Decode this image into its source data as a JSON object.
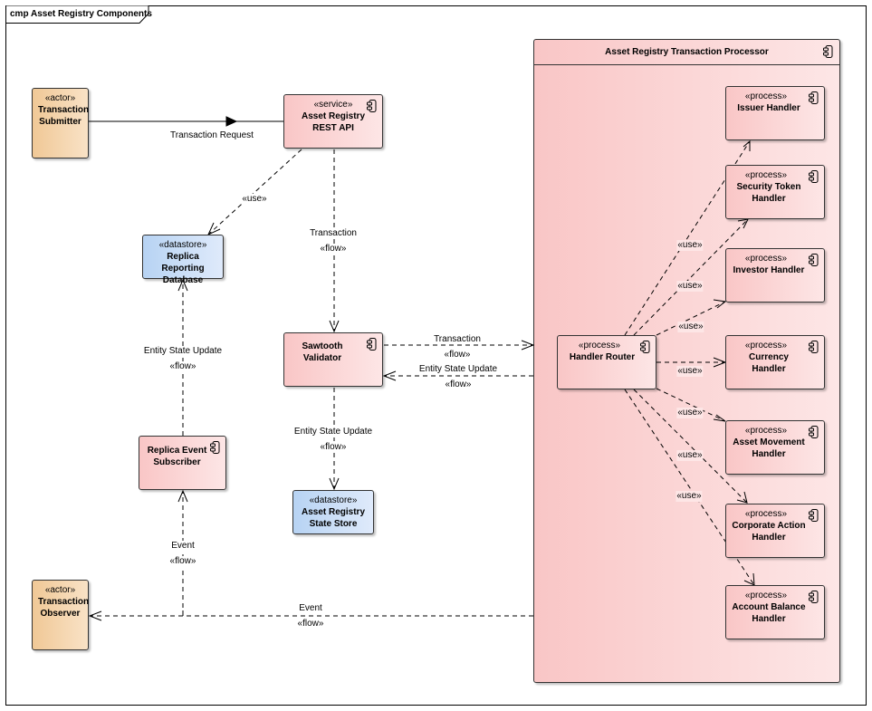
{
  "frame": {
    "title": "cmp Asset Registry Components"
  },
  "nodes": {
    "transaction_submitter": {
      "stereotype": "«actor»",
      "name_lines": [
        "Transaction",
        "Submitter"
      ]
    },
    "rest_api": {
      "stereotype": "«service»",
      "name_lines": [
        "Asset Registry",
        "REST API"
      ],
      "icon": "component-icon"
    },
    "replica_db": {
      "stereotype": "«datastore»",
      "name_lines": [
        "Replica Reporting",
        "Database"
      ]
    },
    "sawtooth_validator": {
      "name_lines": [
        "Sawtooth",
        "Validator"
      ],
      "icon": "component-icon"
    },
    "replica_subscriber": {
      "name_lines": [
        "Replica Event",
        "Subscriber"
      ],
      "icon": "component-icon"
    },
    "state_store": {
      "stereotype": "«datastore»",
      "name_lines": [
        "Asset Registry",
        "State Store"
      ]
    },
    "transaction_observer": {
      "stereotype": "«actor»",
      "name_lines": [
        "Transaction",
        "Observer"
      ]
    },
    "processor": {
      "title": "Asset Registry Transaction Processor",
      "icon": "component-icon"
    },
    "handler_router": {
      "stereotype": "«process»",
      "name_lines": [
        "Handler Router"
      ],
      "icon": "component-icon"
    },
    "issuer_handler": {
      "stereotype": "«process»",
      "name_lines": [
        "Issuer Handler"
      ],
      "icon": "component-icon"
    },
    "security_token_handler": {
      "stereotype": "«process»",
      "name_lines": [
        "Security Token",
        "Handler"
      ],
      "icon": "component-icon"
    },
    "investor_handler": {
      "stereotype": "«process»",
      "name_lines": [
        "Investor Handler"
      ],
      "icon": "component-icon"
    },
    "currency_handler": {
      "stereotype": "«process»",
      "name_lines": [
        "Currency Handler"
      ],
      "icon": "component-icon"
    },
    "asset_movement_handler": {
      "stereotype": "«process»",
      "name_lines": [
        "Asset Movement",
        "Handler"
      ],
      "icon": "component-icon"
    },
    "corporate_action_handler": {
      "stereotype": "«process»",
      "name_lines": [
        "Corporate Action",
        "Handler"
      ],
      "icon": "component-icon"
    },
    "account_balance_handler": {
      "stereotype": "«process»",
      "name_lines": [
        "Account Balance",
        "Handler"
      ],
      "icon": "component-icon"
    }
  },
  "connectors": {
    "transaction_request": {
      "name": "Transaction Request"
    },
    "api_uses_db": {
      "stereotype": "«use»"
    },
    "api_to_validator": {
      "name": "Transaction",
      "stereotype": "«flow»"
    },
    "validator_to_router": {
      "name": "Transaction",
      "stereotype": "«flow»"
    },
    "router_to_validator": {
      "name": "Entity State Update",
      "stereotype": "«flow»"
    },
    "validator_to_store": {
      "name": "Entity State Update",
      "stereotype": "«flow»"
    },
    "subscriber_to_db": {
      "name": "Entity State Update",
      "stereotype": "«flow»"
    },
    "event_to_subscriber": {
      "name": "Event",
      "stereotype": "«flow»"
    },
    "event_to_observer": {
      "name": "Event",
      "stereotype": "«flow»"
    },
    "use_labels": [
      "«use»",
      "«use»",
      "«use»",
      "«use»",
      "«use»",
      "«use»",
      "«use»"
    ]
  },
  "colors": {
    "component_fill_start": "#f9c6c6",
    "component_fill_end": "#fde6e6",
    "actor_fill_start": "#f0c896",
    "actor_fill_end": "#f9e2c6",
    "datastore_fill_start": "#b7d3f3",
    "datastore_fill_end": "#dfeafb",
    "line": "#000000"
  }
}
